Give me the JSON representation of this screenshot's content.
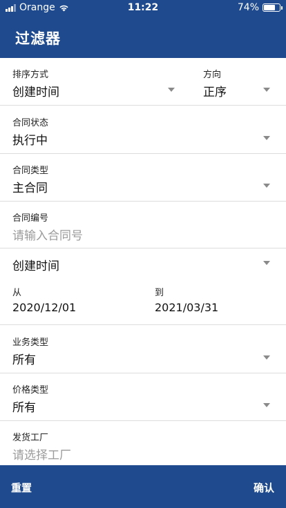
{
  "status_bar": {
    "carrier": "Orange",
    "time": "11:22",
    "battery": "74%",
    "battery_level": 0.74
  },
  "header": {
    "title": "过滤器"
  },
  "sort": {
    "label": "排序方式",
    "value": "创建时间",
    "direction_label": "方向",
    "direction_value": "正序"
  },
  "contract_status": {
    "label": "合同状态",
    "value": "执行中"
  },
  "contract_type": {
    "label": "合同类型",
    "value": "主合同"
  },
  "contract_number": {
    "label": "合同编号",
    "placeholder": "请输入合同号"
  },
  "date_filter": {
    "value": "创建时间",
    "from_label": "从",
    "from_value": "2020/12/01",
    "to_label": "到",
    "to_value": "2021/03/31"
  },
  "business_type": {
    "label": "业务类型",
    "value": "所有"
  },
  "price_type": {
    "label": "价格类型",
    "value": "所有"
  },
  "factory": {
    "label": "发货工厂",
    "placeholder": "请选择工厂"
  },
  "footer": {
    "reset": "重置",
    "confirm": "确认"
  }
}
